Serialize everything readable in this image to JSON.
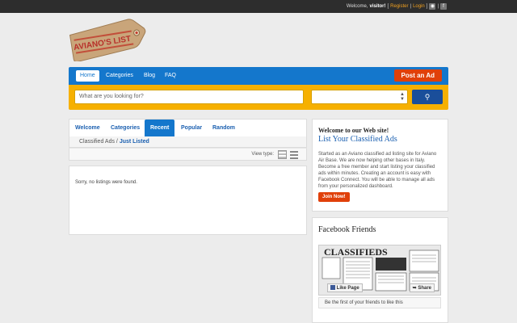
{
  "topbar": {
    "welcome": "Welcome,",
    "user": "visitor!",
    "sep1": "[",
    "register": "Register",
    "pipe": "|",
    "login": "Login",
    "sep2": "]",
    "pipe2": "|",
    "rss_glyph": "◉",
    "facebook_glyph": "f"
  },
  "logo": {
    "text": "AVIANO'S LIST"
  },
  "nav": {
    "items": [
      "Home",
      "Categories",
      "Blog",
      "FAQ"
    ],
    "post_label": "Post an Ad"
  },
  "search": {
    "placeholder": "What are you looking for?",
    "category_value": "",
    "submit_glyph": "⚲"
  },
  "tabs": [
    "Welcome",
    "Categories",
    "Recent",
    "Popular",
    "Random"
  ],
  "breadcrumb": {
    "root": "Classified Ads",
    "sep": "/",
    "current": "Just Listed"
  },
  "view": {
    "label": "View type:"
  },
  "listings": {
    "empty": "Sorry, no listings were found."
  },
  "welcome_box": {
    "heading": "Welcome to our Web site!",
    "subheading": "List Your Classified Ads",
    "body": "Started as an Aviano classified ad listing site for Aviano Air Base. We are now helping other bases in Italy. Become a free member and start listing your classified ads within minutes. Creating an account is easy with Facebook Connect. You will be able to manage all ads from your personalized dashboard.",
    "join_label": "Join Now!"
  },
  "facebook": {
    "title": "Facebook Friends",
    "banner": "CLASSIFIEDS",
    "like_label": "Like Page",
    "share_label": "Share",
    "friends_text": "Be the first of your friends to like this"
  },
  "colors": {
    "nav": "#1477cc",
    "search": "#f6b000",
    "accent": "#e0400a",
    "link": "#1a5fb0"
  }
}
